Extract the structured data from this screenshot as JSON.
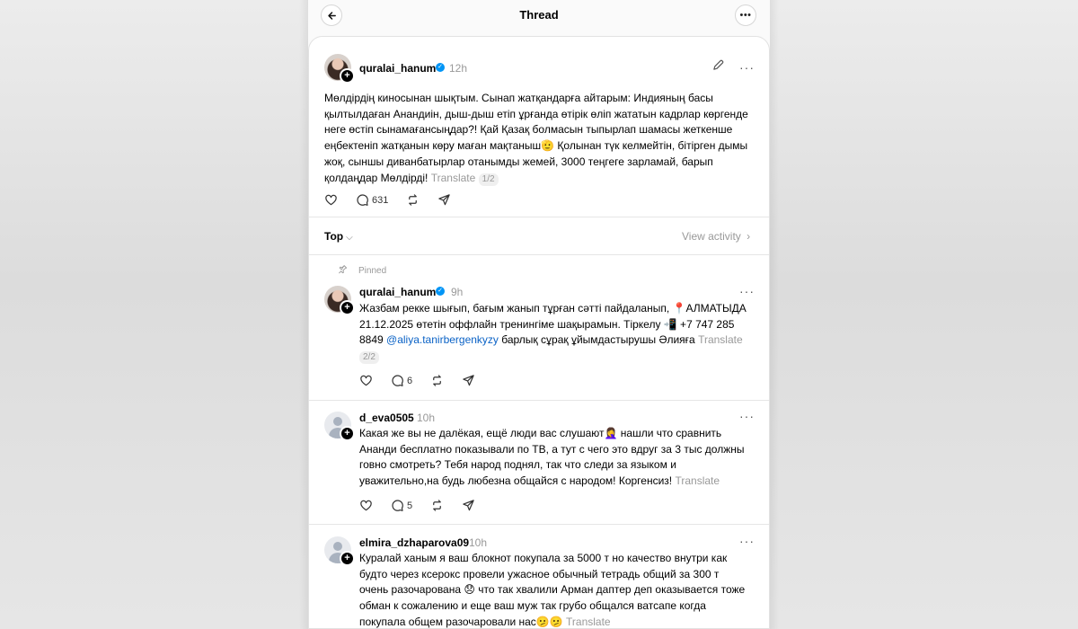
{
  "header": {
    "title": "Thread"
  },
  "main_post": {
    "username": "quralai_hanum",
    "time": "12h",
    "text": "Мөлдірдің киносынан шықтым. Сынап жатқандарға айтарым: Индияның басы қылтылдаған Анандиін, дыш-дыш етіп ұрғанда өтірік өліп жататын кадрлар көргенде неге өстіп сынамағансыңдар?! Қай Қазақ болмасын тыпырлап шамасы жеткенше еңбектеніп жатқанын көру маған мақтаныш🫡 Қолынан түк келмейтін, бітірген дымы жоқ, сыншы диванбатырлар отанымды жемей, 3000 теңгеге зарламай, барып қолдаңдар Мөлдірді!",
    "translate": "Translate",
    "page": "1/2",
    "comments": "631"
  },
  "sort": {
    "label": "Top",
    "view_activity": "View activity"
  },
  "pinned_reply": {
    "pinned_label": "Pinned",
    "username": "quralai_hanum",
    "time": "9h",
    "text_before": "Жазбам рекке шығып, бағым жанып тұрған сәтті пайдаланып, 📍АЛМАТЫДА 21.12.2025 өтетін оффлайн тренингіме шақырамын. Тіркелу 📲 +7 747 285 8849 ",
    "mention": "@aliya.tanirbergenkyzy",
    "text_after": " барлық сұрақ ұйымдастырушы Әлияға ",
    "translate": "Translate",
    "page": "2/2",
    "comments": "6"
  },
  "reply1": {
    "username": "d_eva0505",
    "time": "10h",
    "text": "Какая же вы не далёкая, ещё люди вас слушают🤦‍♀️ нашли что сравнить Ананди бесплатно показывали по ТВ, а тут с чего это вдруг за 3 тыс должны говно смотреть? Тебя народ поднял, так что следи за языком и уважительно,на будь любезна общайся с народом! Коргенсиз! ",
    "translate": "Translate",
    "comments": "5"
  },
  "reply2": {
    "username": "elmira_dzhaparova09",
    "time": "10h",
    "text": "Куралай ханым я ваш блокнот покупала за 5000 т но качество внутри как будто через ксерокс провели ужасное обычный тетрадь общий за 300 т очень разочарована 😞 что так хвалили Арман даптер деп оказывается тоже обман к сожалению и еще ваш муж так грубо общался ватсапе когда покупала общем разочаровали нас🫤🫤 ",
    "translate": "Translate"
  },
  "icons": {
    "back": "arrow-left-icon",
    "more": "more-dots-icon",
    "edit": "pencil-icon",
    "like": "heart-icon",
    "comment": "comment-bubble-icon",
    "repost": "repost-icon",
    "share": "send-icon",
    "pin": "pin-icon",
    "verified": "verified-badge-icon"
  },
  "colors": {
    "accent_link": "#0a62c6",
    "verified": "#0095f6",
    "muted": "#999999"
  }
}
